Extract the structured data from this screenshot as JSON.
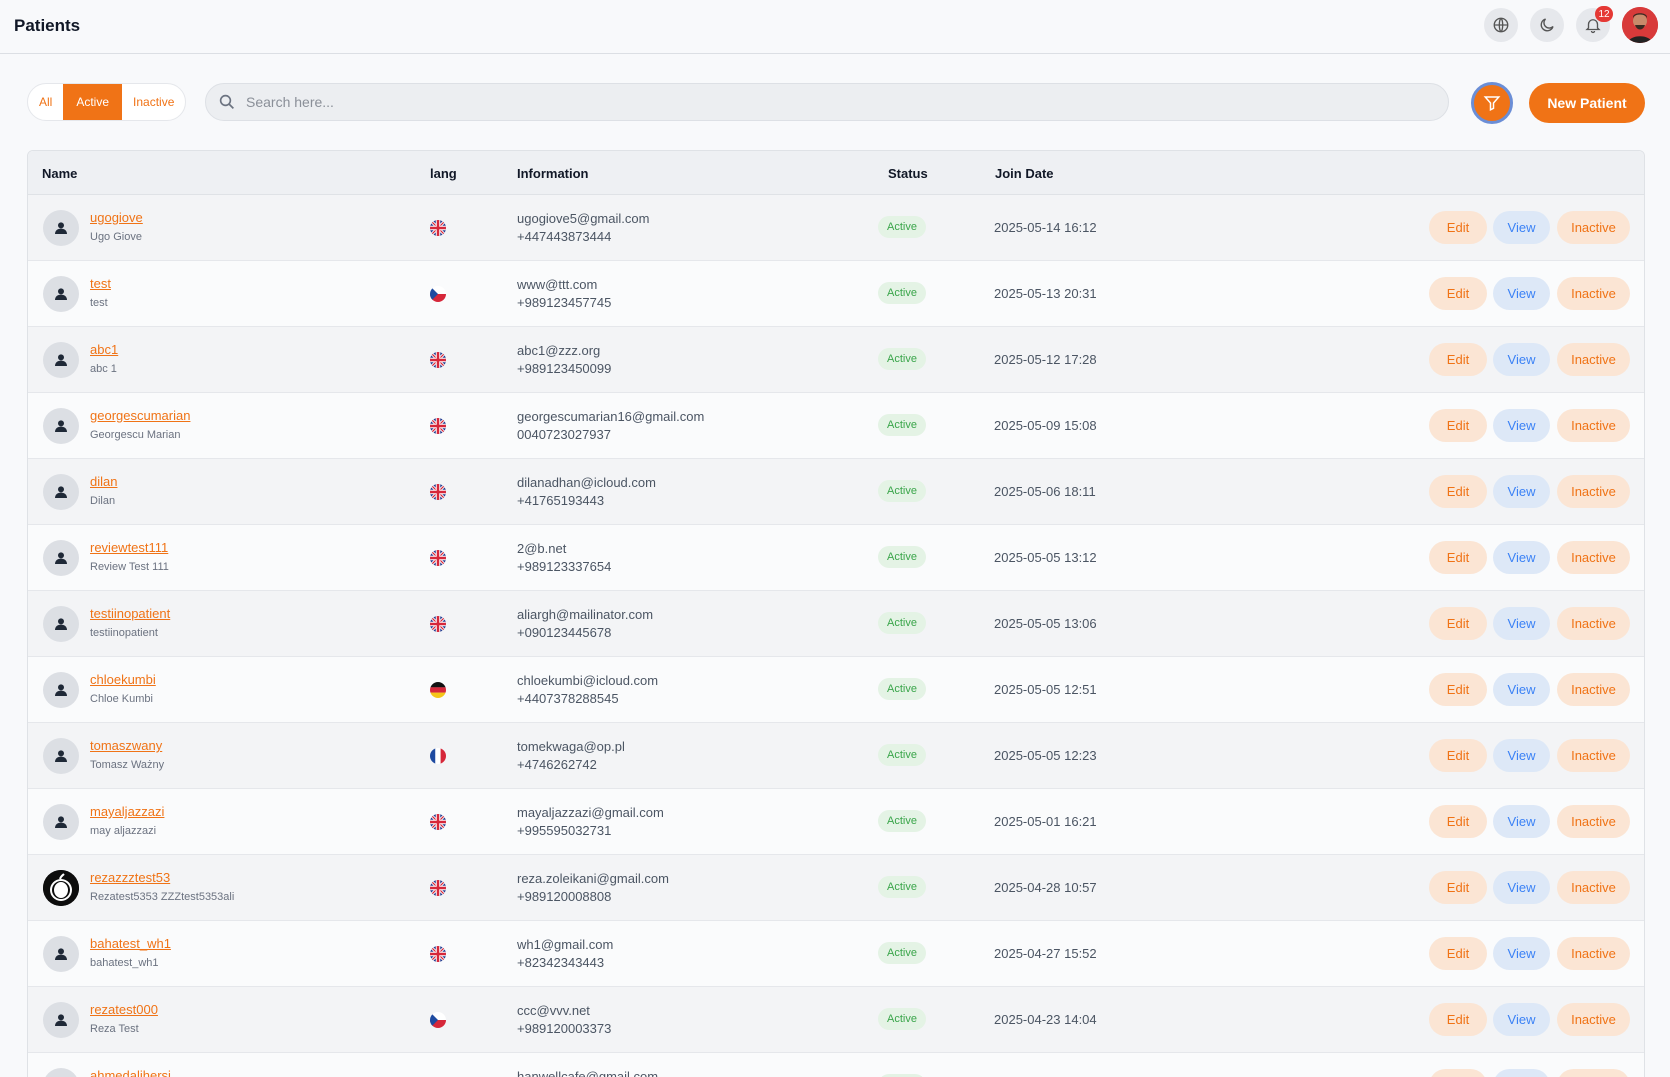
{
  "header": {
    "title": "Patients",
    "notification_count": "12"
  },
  "filters": {
    "all": "All",
    "active": "Active",
    "inactive": "Inactive",
    "selected": "Active"
  },
  "search": {
    "placeholder": "Search here...",
    "value": ""
  },
  "toolbar": {
    "new_patient_label": "New Patient"
  },
  "table": {
    "columns": {
      "name": "Name",
      "lang": "lang",
      "information": "Information",
      "status": "Status",
      "join_date": "Join Date"
    },
    "actions": {
      "edit": "Edit",
      "view": "View",
      "inactive": "Inactive"
    },
    "rows": [
      {
        "username": "ugogiove",
        "fullname": "Ugo Giove",
        "lang": "en",
        "email": "ugogiove5@gmail.com",
        "phone": "+447443873444",
        "status": "Active",
        "join_date": "2025-05-14 16:12"
      },
      {
        "username": "test",
        "fullname": "test",
        "lang": "cs",
        "email": "www@ttt.com",
        "phone": "+989123457745",
        "status": "Active",
        "join_date": "2025-05-13 20:31"
      },
      {
        "username": "abc1",
        "fullname": "abc 1",
        "lang": "en",
        "email": "abc1@zzz.org",
        "phone": "+989123450099",
        "status": "Active",
        "join_date": "2025-05-12 17:28"
      },
      {
        "username": "georgescumarian",
        "fullname": "Georgescu Marian",
        "lang": "en",
        "email": "georgescumarian16@gmail.com",
        "phone": "0040723027937",
        "status": "Active",
        "join_date": "2025-05-09 15:08"
      },
      {
        "username": "dilan",
        "fullname": "Dilan",
        "lang": "en",
        "email": "dilanadhan@icloud.com",
        "phone": "+41765193443",
        "status": "Active",
        "join_date": "2025-05-06 18:11"
      },
      {
        "username": "reviewtest111",
        "fullname": "Review Test 111",
        "lang": "en",
        "email": "2@b.net",
        "phone": "+989123337654",
        "status": "Active",
        "join_date": "2025-05-05 13:12"
      },
      {
        "username": "testiinopatient",
        "fullname": "testiinopatient",
        "lang": "en",
        "email": "aliargh@mailinator.com",
        "phone": "+090123445678",
        "status": "Active",
        "join_date": "2025-05-05 13:06"
      },
      {
        "username": "chloekumbi",
        "fullname": "Chloe Kumbi",
        "lang": "de",
        "email": "chloekumbi@icloud.com",
        "phone": "+4407378288545",
        "status": "Active",
        "join_date": "2025-05-05 12:51"
      },
      {
        "username": "tomaszwany",
        "fullname": "Tomasz Ważny",
        "lang": "fr",
        "email": "tomekwaga@op.pl",
        "phone": "+4746262742",
        "status": "Active",
        "join_date": "2025-05-05 12:23"
      },
      {
        "username": "mayaljazzazi",
        "fullname": "may aljazzazi",
        "lang": "en",
        "email": "mayaljazzazi@gmail.com",
        "phone": "+995595032731",
        "status": "Active",
        "join_date": "2025-05-01 16:21"
      },
      {
        "username": "rezazzztest53",
        "fullname": "Rezatest5353 ZZZtest5353ali",
        "lang": "en",
        "email": "reza.zoleikani@gmail.com",
        "phone": "+989120008808",
        "status": "Active",
        "join_date": "2025-04-28 10:57",
        "custom_avatar": true
      },
      {
        "username": "bahatest_wh1",
        "fullname": "bahatest_wh1",
        "lang": "en",
        "email": "wh1@gmail.com",
        "phone": "+82342343443",
        "status": "Active",
        "join_date": "2025-04-27 15:52"
      },
      {
        "username": "rezatest000",
        "fullname": "Reza Test",
        "lang": "cs",
        "email": "ccc@vvv.net",
        "phone": "+989120003373",
        "status": "Active",
        "join_date": "2025-04-23 14:04"
      },
      {
        "username": "ahmedalihersi",
        "fullname": "",
        "lang": "en",
        "email": "hanwellcafe@gmail.com",
        "phone": "",
        "status": "Active",
        "join_date": ""
      }
    ]
  },
  "colors": {
    "accent": "#f07316",
    "status_green": "#3aa54a",
    "view_blue": "#3b82f6"
  }
}
